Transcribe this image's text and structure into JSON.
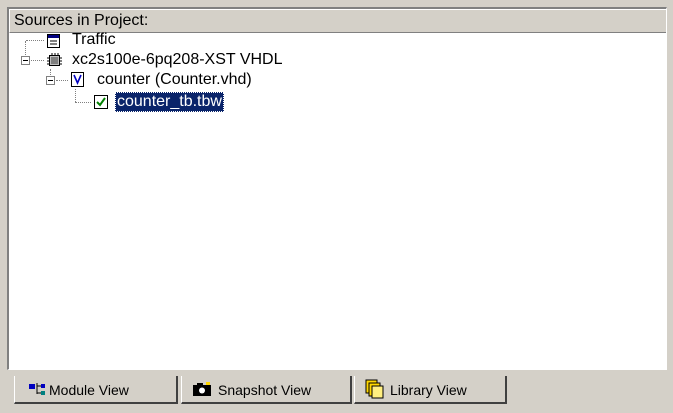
{
  "panel": {
    "header": "Sources in Project:"
  },
  "tree": [
    {
      "label": "Traffic",
      "icon": "project-file-icon"
    },
    {
      "label": "xc2s100e-6pq208-XST VHDL",
      "icon": "chip-icon"
    },
    {
      "label": "counter (Counter.vhd)",
      "icon": "vhdl-module-icon"
    },
    {
      "label": "counter_tb.tbw",
      "icon": "testbench-icon",
      "selected": true
    }
  ],
  "tabs": [
    {
      "label": "Module View",
      "icon": "module-view-icon",
      "active": true
    },
    {
      "label": "Snapshot View",
      "icon": "camera-icon"
    },
    {
      "label": "Library View",
      "icon": "library-icon"
    }
  ]
}
